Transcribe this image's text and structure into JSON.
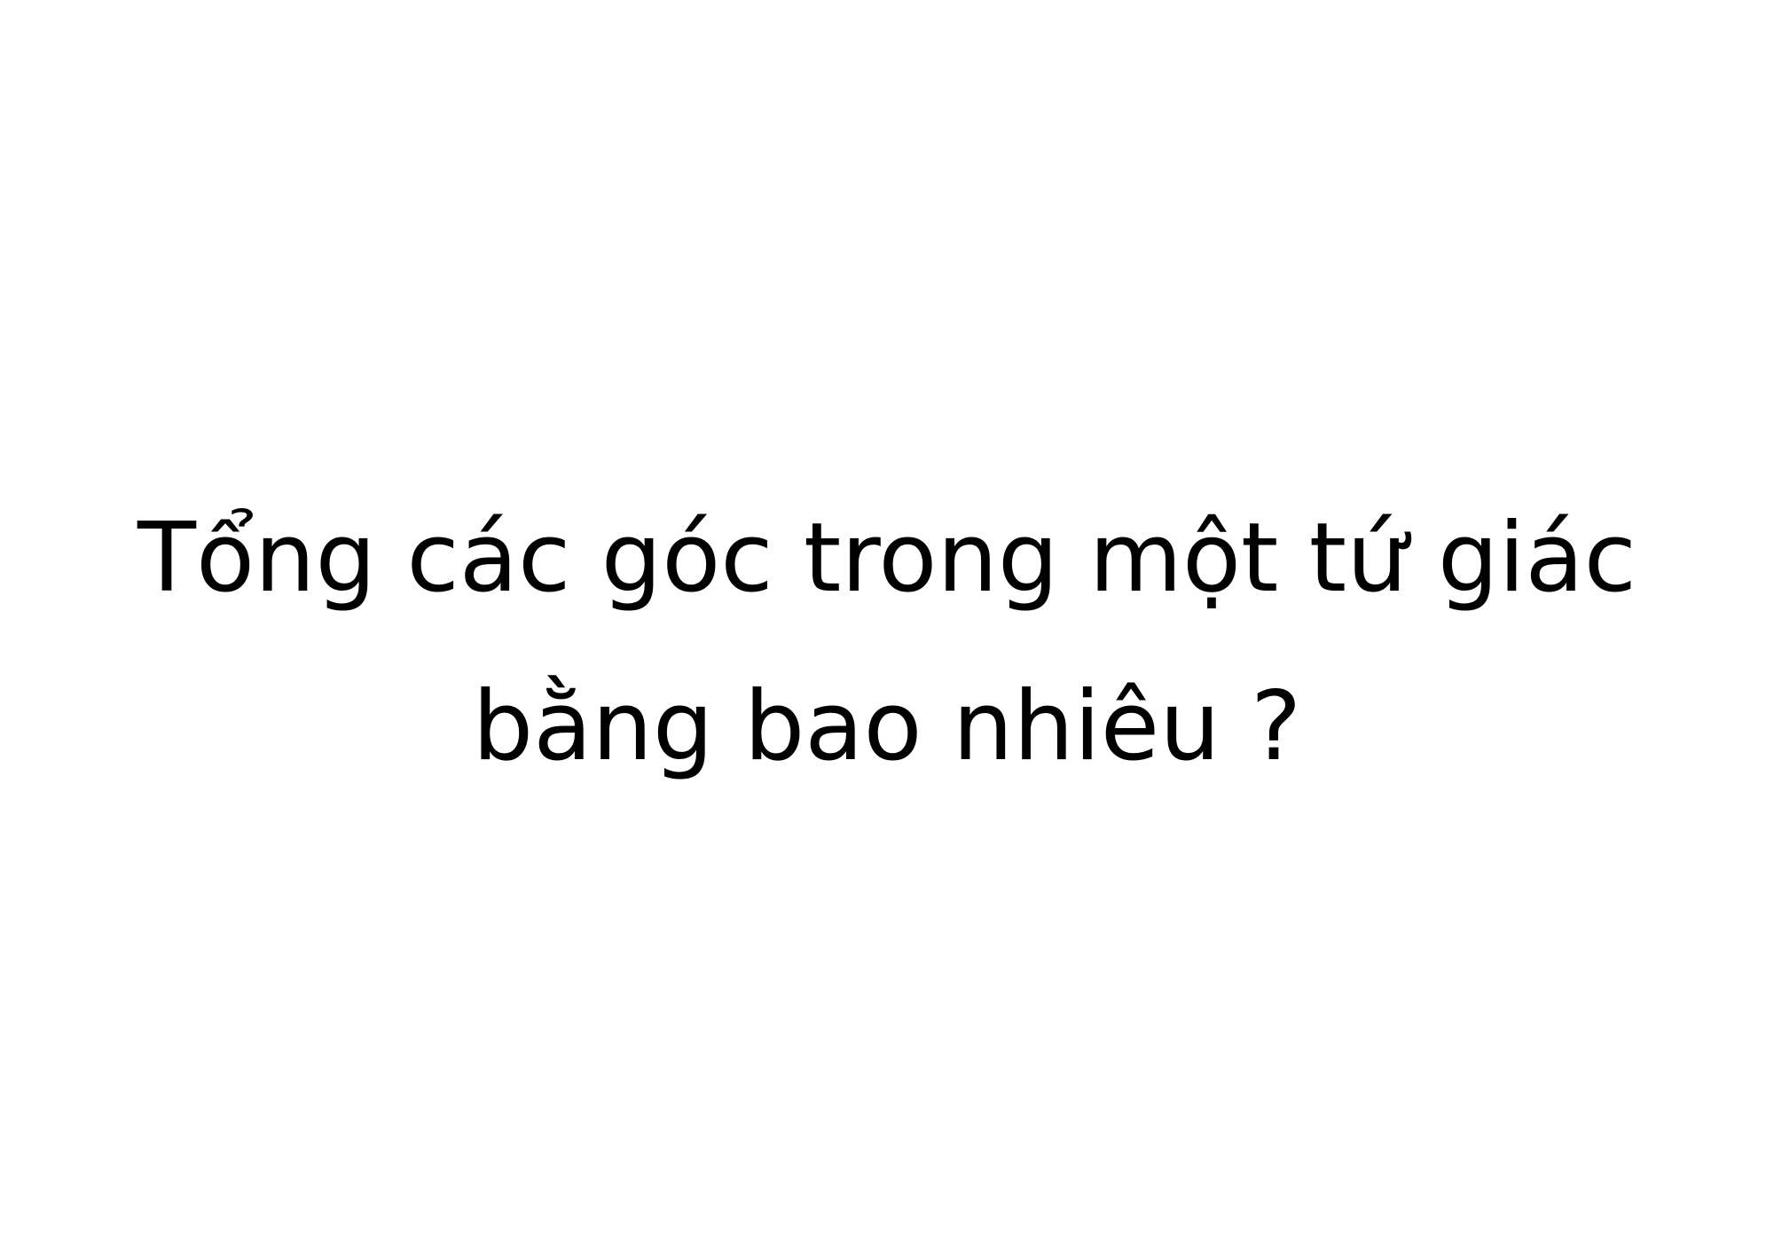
{
  "slide": {
    "question": "Tổng các góc trong một tứ giác bằng bao nhiêu ?",
    "text_color": "#000000",
    "background_color": "#ffffff"
  }
}
